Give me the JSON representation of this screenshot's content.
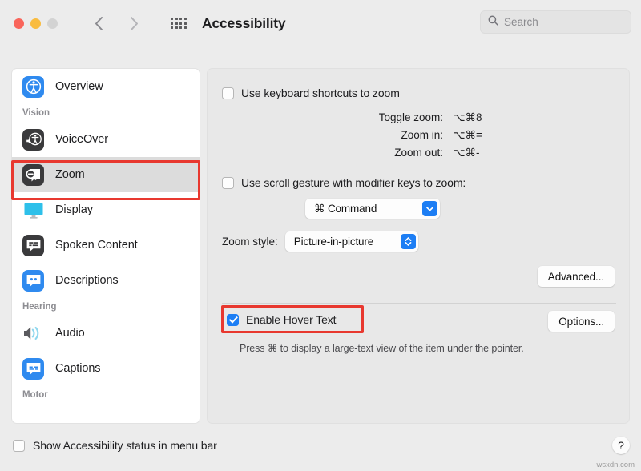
{
  "window": {
    "title": "Accessibility",
    "traffic_lights": [
      "close",
      "minimize",
      "zoom"
    ],
    "back_icon": "chevron-left-icon",
    "forward_icon": "chevron-right-icon",
    "grid_icon": "show-all-grid-icon"
  },
  "search": {
    "placeholder": "Search",
    "value": "",
    "icon": "search-icon"
  },
  "sidebar": {
    "items": [
      {
        "type": "item",
        "label": "Overview",
        "icon": "accessibility-person-icon",
        "selected": false
      },
      {
        "type": "group",
        "label": "Vision"
      },
      {
        "type": "item",
        "label": "VoiceOver",
        "icon": "voiceover-icon",
        "selected": false
      },
      {
        "type": "item",
        "label": "Zoom",
        "icon": "zoom-magnifier-icon",
        "selected": true
      },
      {
        "type": "item",
        "label": "Display",
        "icon": "display-monitor-icon",
        "selected": false
      },
      {
        "type": "item",
        "label": "Spoken Content",
        "icon": "spoken-content-icon",
        "selected": false
      },
      {
        "type": "item",
        "label": "Descriptions",
        "icon": "descriptions-icon",
        "selected": false
      },
      {
        "type": "group",
        "label": "Hearing"
      },
      {
        "type": "item",
        "label": "Audio",
        "icon": "audio-speaker-icon",
        "selected": false
      },
      {
        "type": "item",
        "label": "Captions",
        "icon": "captions-icon",
        "selected": false
      },
      {
        "type": "group",
        "label": "Motor"
      }
    ]
  },
  "main": {
    "keyboard_shortcuts": {
      "label": "Use keyboard shortcuts to zoom",
      "checked": false,
      "rows": [
        {
          "name": "Toggle zoom:",
          "key": "⌥⌘8"
        },
        {
          "name": "Zoom in:",
          "key": "⌥⌘="
        },
        {
          "name": "Zoom out:",
          "key": "⌥⌘-"
        }
      ]
    },
    "scroll_gesture": {
      "label": "Use scroll gesture with modifier keys to zoom:",
      "checked": false,
      "modifier_value": "⌘ Command",
      "modifier_icon": "chevron-down-icon"
    },
    "zoom_style": {
      "label": "Zoom style:",
      "value": "Picture-in-picture",
      "icon": "up-down-chevron-icon"
    },
    "advanced_button": "Advanced...",
    "hover_text": {
      "label": "Enable Hover Text",
      "checked": true,
      "options_button": "Options...",
      "hint": "Press ⌘ to display a large-text view of the item under the pointer."
    }
  },
  "footer": {
    "menu_bar_status": {
      "label": "Show Accessibility status in menu bar",
      "checked": false
    },
    "help_label": "?",
    "watermark": "wsxdn.com"
  },
  "colors": {
    "accent": "#1d7ef4",
    "annotation": "#e8382f",
    "window_bg": "#ececec",
    "sidebar_bg": "#ffffff",
    "content_bg": "#e8e8e8"
  }
}
